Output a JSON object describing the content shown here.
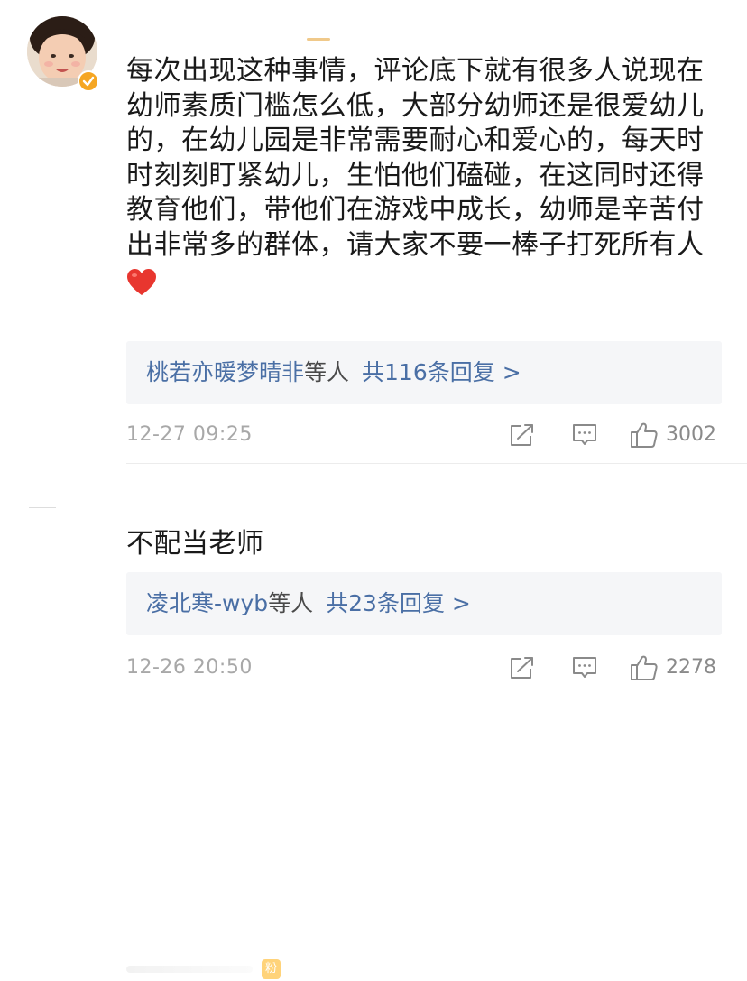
{
  "comments": [
    {
      "text": "每次出现这种事情，评论底下就有很多人说现在幼师素质门槛怎么低，大部分幼师还是很爱幼儿的，在幼儿园是非常需要耐心和爱心的，每天时时刻刻盯紧幼儿，生怕他们磕碰，在这同时还得教育他们，带他们在游戏中成长，幼师是辛苦付出非常多的群体，请大家不要一棒子打死所有人",
      "emoji": "heart-icon",
      "reply_names": "桃若亦暖梦晴非",
      "reply_suffix": "等人",
      "reply_count": "共116条回复 >",
      "timestamp": "12-27 09:25",
      "likes": "3002"
    },
    {
      "text": "不配当老师",
      "fan_badge": "粉",
      "reply_names": "凌北寒-wyb",
      "reply_suffix": "等人",
      "reply_count": "共23条回复 >",
      "timestamp": "12-26 20:50",
      "likes": "2278"
    }
  ],
  "colors": {
    "link": "#4a6fa5",
    "meta": "#a8a8a8",
    "reply_bg": "#f5f6f8",
    "verified": "#f5a623",
    "heart": "#e8362f"
  },
  "icons": [
    "share-icon",
    "comment-icon",
    "like-icon",
    "verified-icon",
    "heart-icon"
  ]
}
